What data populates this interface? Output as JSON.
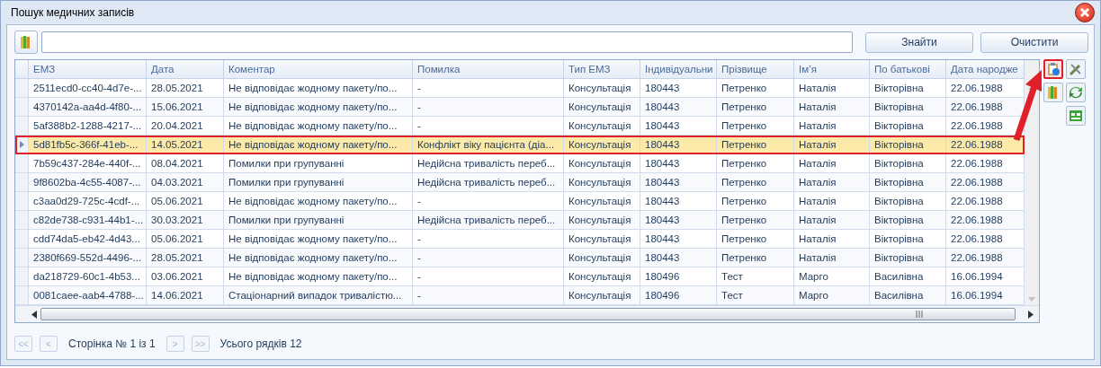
{
  "window": {
    "title": "Пошук медичних записів"
  },
  "search": {
    "buttons": [
      "Знайти",
      "Очистити"
    ]
  },
  "table": {
    "columns": [
      "ЕМЗ",
      "Дата",
      "Коментар",
      "Помилка",
      "Тип ЕМЗ",
      "Індивідуальни",
      "Прізвище",
      "Ім’я",
      "По батькові",
      "Дата народже"
    ],
    "rows": [
      {
        "selected": false,
        "cells": [
          "2511ecd0-cc40-4d7e-...",
          "28.05.2021",
          "Не відповідає жодному пакету/по...",
          "-",
          "Консультація",
          "180443",
          "Петренко",
          "Наталія",
          "Вікторівна",
          "22.06.1988"
        ]
      },
      {
        "selected": false,
        "cells": [
          "4370142a-aa4d-4f80-...",
          "15.06.2021",
          "Не відповідає жодному пакету/по...",
          "-",
          "Консультація",
          "180443",
          "Петренко",
          "Наталія",
          "Вікторівна",
          "22.06.1988"
        ]
      },
      {
        "selected": false,
        "cells": [
          "5af388b2-1288-4217-...",
          "20.04.2021",
          "Не відповідає жодному пакету/по...",
          "-",
          "Консультація",
          "180443",
          "Петренко",
          "Наталія",
          "Вікторівна",
          "22.06.1988"
        ]
      },
      {
        "selected": true,
        "cells": [
          "5d81fb5c-366f-41eb-...",
          "14.05.2021",
          "Не відповідає жодному пакету/по...",
          "Конфлікт віку пацієнта (діа...",
          "Консультація",
          "180443",
          "Петренко",
          "Наталія",
          "Вікторівна",
          "22.06.1988"
        ]
      },
      {
        "selected": false,
        "cells": [
          "7b59c437-284e-440f-...",
          "08.04.2021",
          "Помилки при групуванні",
          "Недійсна тривалість переб...",
          "Консультація",
          "180443",
          "Петренко",
          "Наталія",
          "Вікторівна",
          "22.06.1988"
        ]
      },
      {
        "selected": false,
        "cells": [
          "9f8602ba-4c55-4087-...",
          "04.03.2021",
          "Помилки при групуванні",
          "Недійсна тривалість переб...",
          "Консультація",
          "180443",
          "Петренко",
          "Наталія",
          "Вікторівна",
          "22.06.1988"
        ]
      },
      {
        "selected": false,
        "cells": [
          "c3aa0d29-725c-4cdf-...",
          "05.06.2021",
          "Не відповідає жодному пакету/по...",
          "-",
          "Консультація",
          "180443",
          "Петренко",
          "Наталія",
          "Вікторівна",
          "22.06.1988"
        ]
      },
      {
        "selected": false,
        "cells": [
          "c82de738-c931-44b1-...",
          "30.03.2021",
          "Помилки при групуванні",
          "Недійсна тривалість переб...",
          "Консультація",
          "180443",
          "Петренко",
          "Наталія",
          "Вікторівна",
          "22.06.1988"
        ]
      },
      {
        "selected": false,
        "cells": [
          "cdd74da5-eb42-4d43...",
          "05.06.2021",
          "Не відповідає жодному пакету/по...",
          "-",
          "Консультація",
          "180443",
          "Петренко",
          "Наталія",
          "Вікторівна",
          "22.06.1988"
        ]
      },
      {
        "selected": false,
        "cells": [
          "2380f669-552d-4496-...",
          "28.05.2021",
          "Не відповідає жодному пакету/по...",
          "-",
          "Консультація",
          "180443",
          "Петренко",
          "Наталія",
          "Вікторівна",
          "22.06.1988"
        ]
      },
      {
        "selected": false,
        "cells": [
          "da218729-60c1-4b53...",
          "03.06.2021",
          "Не відповідає жодному пакету/по...",
          "-",
          "Консультація",
          "180496",
          "Тест",
          "Марго",
          "Василівна",
          "16.06.1994"
        ]
      },
      {
        "selected": false,
        "cells": [
          "0081caee-aab4-4788-...",
          "14.06.2021",
          "Стаціонарний випадок тривалістю...",
          "-",
          "Консультація",
          "180496",
          "Тест",
          "Марго",
          "Василівна",
          "16.06.1994"
        ]
      }
    ]
  },
  "tools": [
    {
      "kind": "clipboard",
      "highlighted": true
    },
    {
      "kind": "tools",
      "highlighted": false
    },
    {
      "kind": "folder",
      "highlighted": false
    },
    {
      "kind": "refresh",
      "highlighted": false
    },
    {
      "kind": "table",
      "highlighted": false
    }
  ],
  "pager": [
    {
      "kind": "button",
      "label": "<<",
      "disabled": true
    },
    {
      "kind": "button",
      "label": "<",
      "disabled": true
    },
    {
      "kind": "text",
      "label": "Сторінка № 1 із 1"
    },
    {
      "kind": "button",
      "label": ">",
      "disabled": true
    },
    {
      "kind": "button",
      "label": ">>",
      "disabled": true
    },
    {
      "kind": "text",
      "label": "Усього рядків 12"
    }
  ]
}
